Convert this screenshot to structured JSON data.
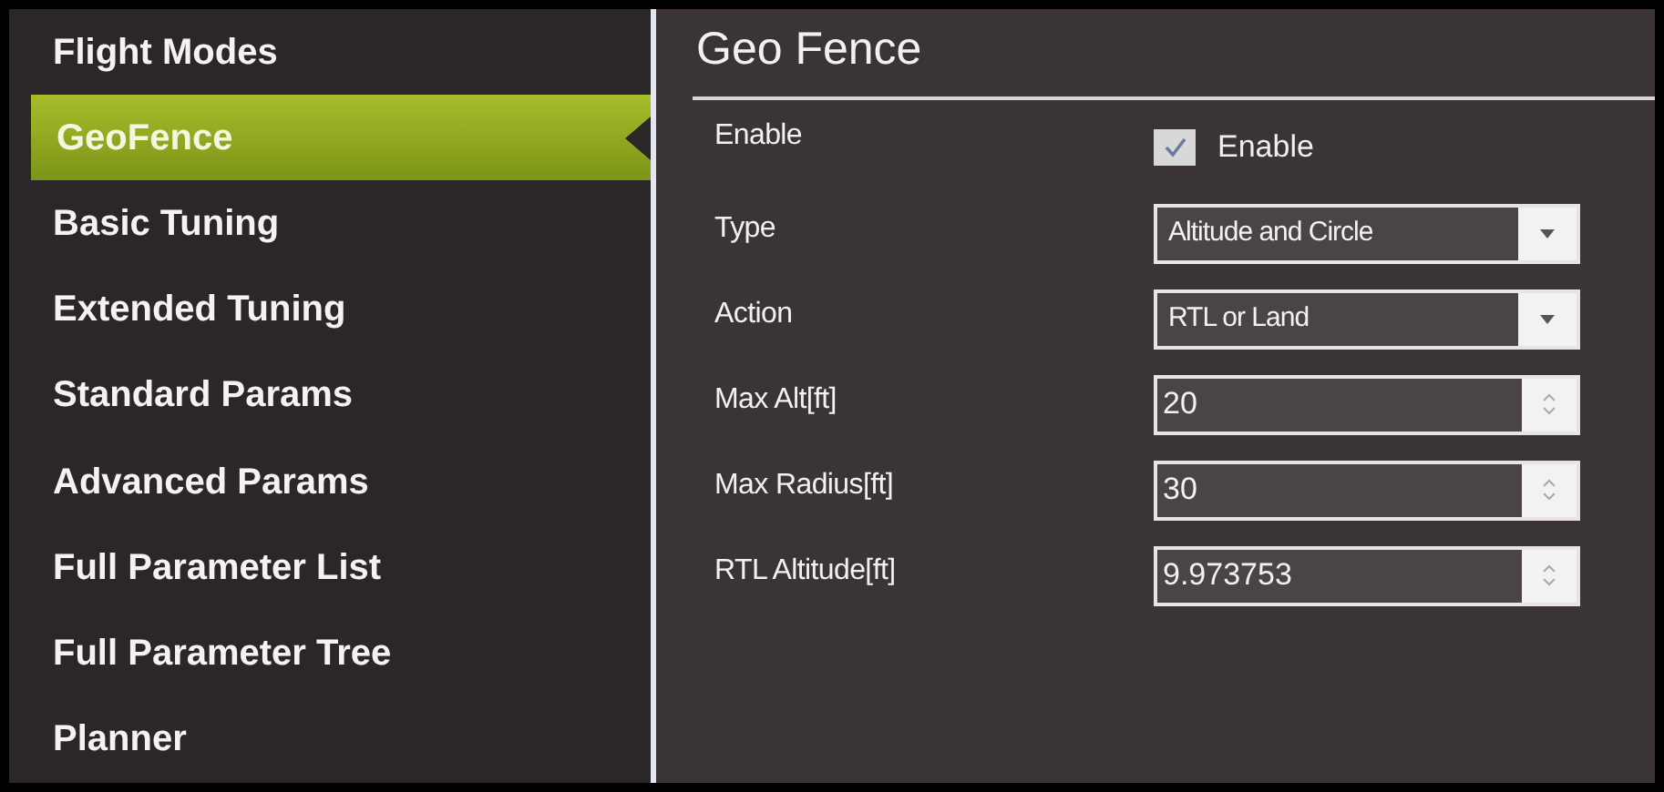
{
  "sidebar": {
    "items": [
      {
        "label": "Flight Modes",
        "selected": false
      },
      {
        "label": "GeoFence",
        "selected": true
      },
      {
        "label": "Basic Tuning",
        "selected": false
      },
      {
        "label": "Extended Tuning",
        "selected": false
      },
      {
        "label": "Standard Params",
        "selected": false
      },
      {
        "label": "Advanced Params",
        "selected": false
      },
      {
        "label": "Full Parameter List",
        "selected": false
      },
      {
        "label": "Full Parameter Tree",
        "selected": false
      },
      {
        "label": "Planner",
        "selected": false
      }
    ]
  },
  "panel": {
    "title": "Geo Fence",
    "rows": [
      {
        "kind": "checkbox",
        "label": "Enable",
        "text": "Enable",
        "checked": true
      },
      {
        "kind": "dropdown",
        "label": "Type",
        "value": "Altitude and Circle"
      },
      {
        "kind": "dropdown",
        "label": "Action",
        "value": "RTL or Land"
      },
      {
        "kind": "spin",
        "label": "Max Alt[ft]",
        "value": "20"
      },
      {
        "kind": "spin",
        "label": "Max Radius[ft]",
        "value": "30"
      },
      {
        "kind": "spin",
        "label": "RTL Altitude[ft]",
        "value": "9.973753"
      }
    ]
  }
}
